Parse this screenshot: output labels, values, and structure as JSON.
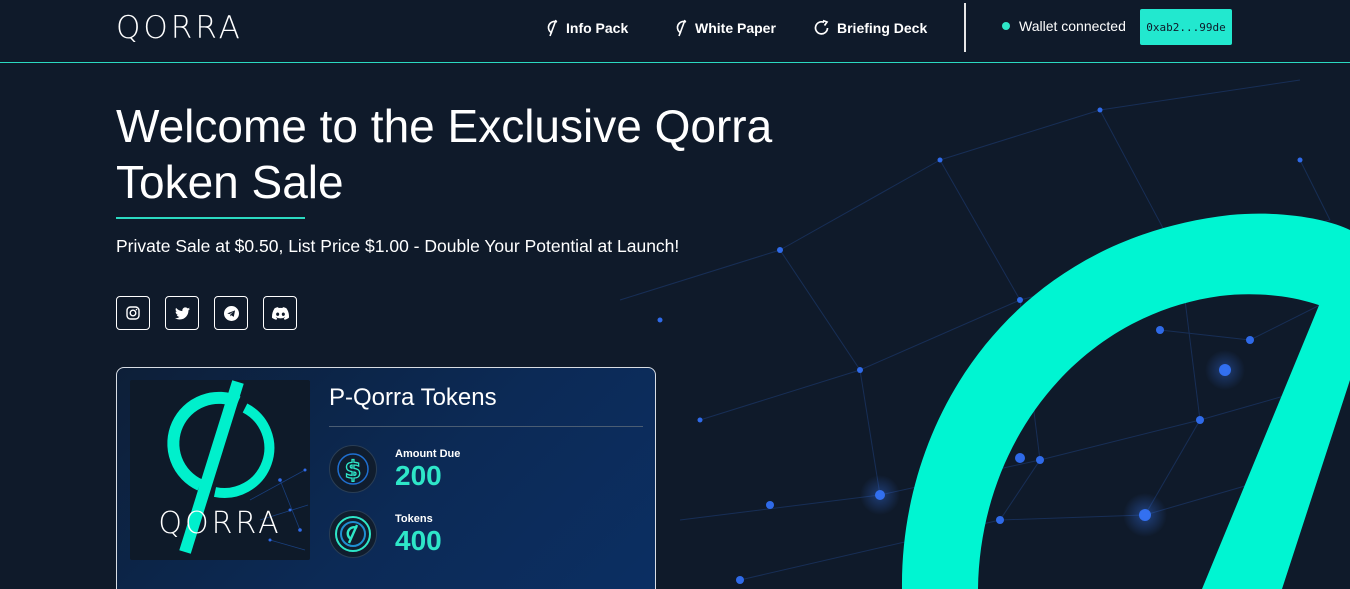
{
  "brand": {
    "logo_text": "QORRA"
  },
  "nav": {
    "items": [
      {
        "label": "Info Pack",
        "icon": "qorra-mark-icon"
      },
      {
        "label": "White Paper",
        "icon": "qorra-mark-icon"
      },
      {
        "label": "Briefing Deck",
        "icon": "refresh-icon"
      }
    ]
  },
  "wallet": {
    "status_text": "Wallet connected",
    "address": "0xab2...99de",
    "status_color": "#2ee6c8"
  },
  "hero": {
    "title_line1": "Welcome to the Exclusive Qorra",
    "title_line2": "Token Sale",
    "subtitle": "Private Sale at $0.50, List Price $1.00 - Double Your Potential at Launch!"
  },
  "socials": [
    {
      "name": "instagram-icon"
    },
    {
      "name": "twitter-icon"
    },
    {
      "name": "telegram-icon"
    },
    {
      "name": "discord-icon"
    }
  ],
  "card": {
    "title": "P-Qorra Tokens",
    "image_logo_text": "QORRA",
    "stats": [
      {
        "label": "Amount Due",
        "value": "200",
        "icon": "dollar-coin-icon"
      },
      {
        "label": "Tokens",
        "value": "400",
        "icon": "qorra-coin-icon"
      }
    ]
  },
  "colors": {
    "background": "#0f1a2a",
    "accent": "#22e8cf",
    "text": "#ffffff"
  }
}
